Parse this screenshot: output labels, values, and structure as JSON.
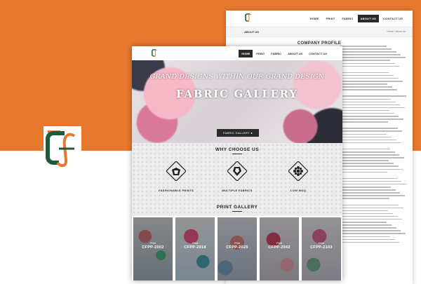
{
  "colors": {
    "accent": "#e8782e",
    "logo_green": "#1f5a3a",
    "logo_orange": "#e8782e",
    "dark": "#2a2a2a"
  },
  "back_page": {
    "nav": [
      "HOME",
      "PRINT",
      "FABRIC",
      "ABOUT US",
      "CONTACT US"
    ],
    "active_nav": "ABOUT US",
    "breadcrumb_title": "ABOUT US",
    "breadcrumb_path": "Home / About Us",
    "section_title": "COMPANY PROFILE"
  },
  "front_page": {
    "nav": [
      "HOME",
      "PRINT",
      "FABRIC",
      "ABOUT US",
      "CONTACT US"
    ],
    "active_nav": "HOME",
    "hero": {
      "tagline": "GRAND DESIGNS WITHIN OUR GRAND DESIGN",
      "title": "FABRIC GALLERY",
      "button": "FABRIC GALLERY"
    },
    "why": {
      "heading": "WHY CHOOSE US",
      "features": [
        {
          "icon": "fabric-print-icon",
          "label": "FASHIONABLE PRINTS"
        },
        {
          "icon": "fabric-roll-icon",
          "label": "MULTIPLE FABRICS"
        },
        {
          "icon": "flower-pattern-icon",
          "label": "LOW MOQ"
        }
      ]
    },
    "print_gallery": {
      "heading": "PRINT GALLERY",
      "tiles": [
        {
          "prefix": "Print",
          "code": "CFPP-2002"
        },
        {
          "prefix": "Print",
          "code": "CFPP-2018"
        },
        {
          "prefix": "Print",
          "code": "CFPP-2025"
        },
        {
          "prefix": "Print",
          "code": "CFPP-2042"
        },
        {
          "prefix": "Print",
          "code": "CFPP-2103"
        }
      ]
    }
  }
}
